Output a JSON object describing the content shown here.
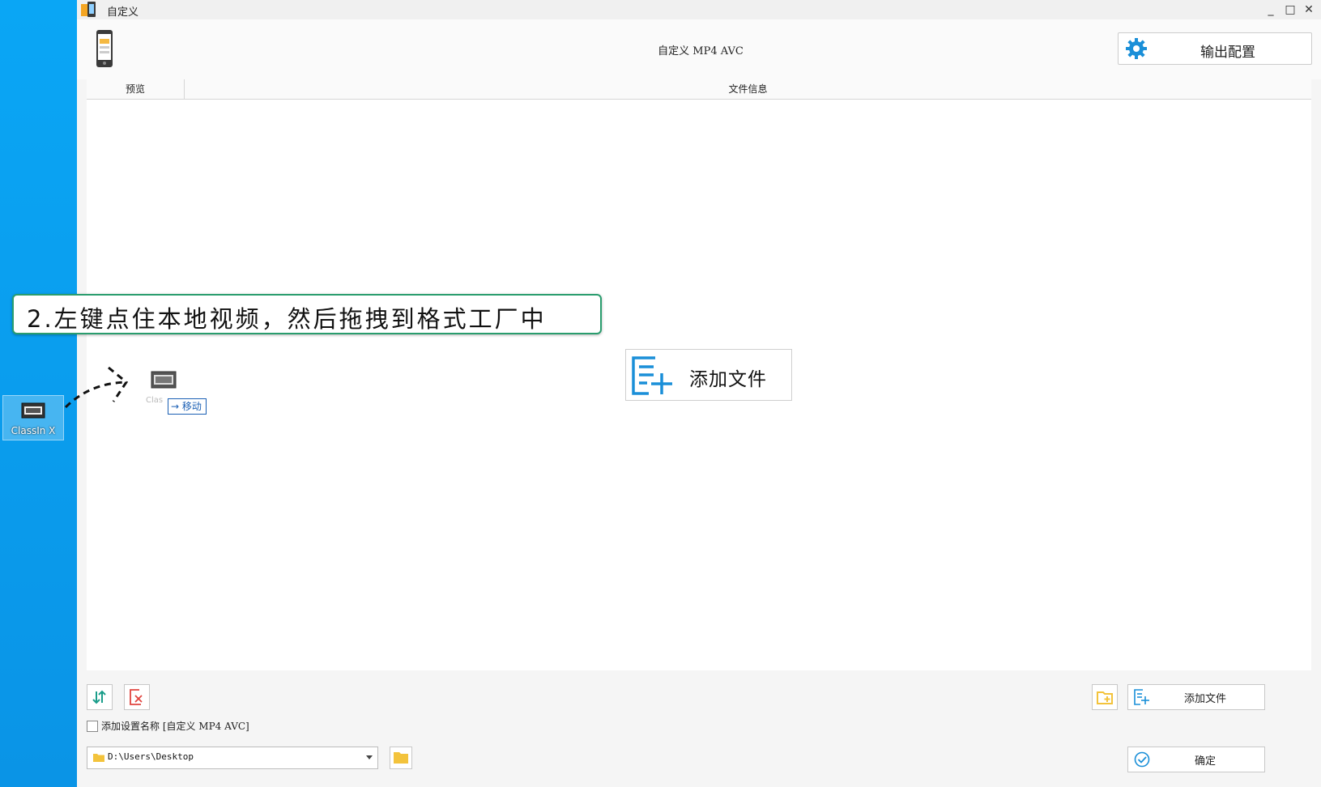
{
  "window": {
    "title": "自定义",
    "controls": {
      "minimize": "_",
      "maximize": "□",
      "close": "✕"
    }
  },
  "desktop": {
    "icon_label": "ClassIn X"
  },
  "header": {
    "profile_title": "自定义 MP4 AVC",
    "output_config_label": "输出配置"
  },
  "file_list": {
    "columns": [
      "预览",
      "文件信息"
    ],
    "add_file_label": "添加文件"
  },
  "overlay": {
    "callout_text": "2.左键点住本地视频，然后拖拽到格式工厂中",
    "drag_ghost_label": "Clas",
    "drag_tooltip": "→ 移动"
  },
  "footer": {
    "add_setting_name_label": "添加设置名称 [自定义 MP4 AVC]",
    "add_setting_name_checked": false,
    "output_path": "D:\\Users\\Desktop",
    "add_file_label": "添加文件",
    "ok_label": "确定"
  },
  "colors": {
    "accent": "#1a8fd8",
    "callout_border": "#2a9d6e",
    "desktop": "#0a9ef0",
    "delete_red": "#e0443e",
    "folder_yellow": "#f3c33c"
  }
}
